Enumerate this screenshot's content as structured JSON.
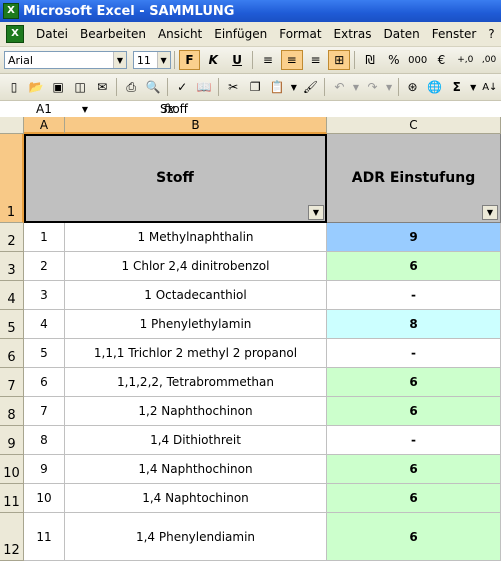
{
  "title": "Microsoft Excel - SAMMLUNG",
  "menu": [
    "Datei",
    "Bearbeiten",
    "Ansicht",
    "Einfügen",
    "Format",
    "Extras",
    "Daten",
    "Fenster",
    "?"
  ],
  "toolbar": {
    "font": "Arial",
    "size": "11",
    "bold_label": "F",
    "italic_label": "K",
    "underline_label": "U",
    "percent": "%",
    "thousands": "000",
    "euro": "€",
    "sigma": "Σ"
  },
  "formula_bar": {
    "namebox": "A1",
    "fx": "fx",
    "value": "Stoff"
  },
  "columns": [
    "A",
    "B",
    "C"
  ],
  "header": {
    "stoff": "Stoff",
    "adr": "ADR Einstufung"
  },
  "rows": [
    {
      "row": "2",
      "nr": "1",
      "stoff": "1 Methylnaphthalin",
      "adr": "9",
      "color": "#99ccff"
    },
    {
      "row": "3",
      "nr": "2",
      "stoff": "1 Chlor 2,4 dinitrobenzol",
      "adr": "6",
      "color": "#ccffcc"
    },
    {
      "row": "4",
      "nr": "3",
      "stoff": "1 Octadecanthiol",
      "adr": "-",
      "color": "#ffffff"
    },
    {
      "row": "5",
      "nr": "4",
      "stoff": "1 Phenylethylamin",
      "adr": "8",
      "color": "#ccffff"
    },
    {
      "row": "6",
      "nr": "5",
      "stoff": "1,1,1 Trichlor 2 methyl 2 propanol",
      "adr": "-",
      "color": "#ffffff"
    },
    {
      "row": "7",
      "nr": "6",
      "stoff": "1,1,2,2, Tetrabrommethan",
      "adr": "6",
      "color": "#ccffcc"
    },
    {
      "row": "8",
      "nr": "7",
      "stoff": "1,2 Naphthochinon",
      "adr": "6",
      "color": "#ccffcc"
    },
    {
      "row": "9",
      "nr": "8",
      "stoff": "1,4 Dithiothreit",
      "adr": "-",
      "color": "#ffffff"
    },
    {
      "row": "10",
      "nr": "9",
      "stoff": "1,4 Naphthochinon",
      "adr": "6",
      "color": "#ccffcc"
    },
    {
      "row": "11",
      "nr": "10",
      "stoff": "1,4 Naphtochinon",
      "adr": "6",
      "color": "#ccffcc"
    },
    {
      "row": "12",
      "nr": "11",
      "stoff": "1,4 Phenylendiamin",
      "adr": "6",
      "color": "#ccffcc"
    }
  ],
  "header_row": "1"
}
